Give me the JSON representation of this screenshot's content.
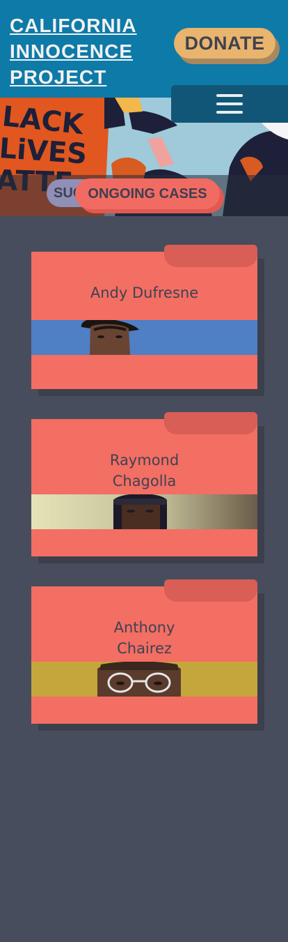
{
  "header": {
    "logo_lines": [
      "CALIFORNIA",
      "INNOCENCE",
      "PROJECT"
    ],
    "donate_label": "DONATE",
    "menu_icon": "hamburger-menu-icon"
  },
  "hero": {
    "sign_lines": [
      "LACK",
      "LiVES",
      "ATTE"
    ]
  },
  "tabs": {
    "success_label": "SUCCESS STORIES",
    "ongoing_label": "ONGOING CASES"
  },
  "cases": [
    {
      "name_lines": [
        "Andy Dufresne"
      ],
      "photo_bg": "#4f7fc4"
    },
    {
      "name_lines": [
        "Raymond",
        "Chagolla"
      ],
      "photo_bg": "#dcdcb0"
    },
    {
      "name_lines": [
        "Anthony",
        "Chairez"
      ],
      "photo_bg": "#c4a63c"
    }
  ],
  "colors": {
    "header_bg": "#0e7aa8",
    "page_bg": "#474d5c",
    "card_bg": "#f36e63",
    "donate_bg": "#e8b46e"
  }
}
